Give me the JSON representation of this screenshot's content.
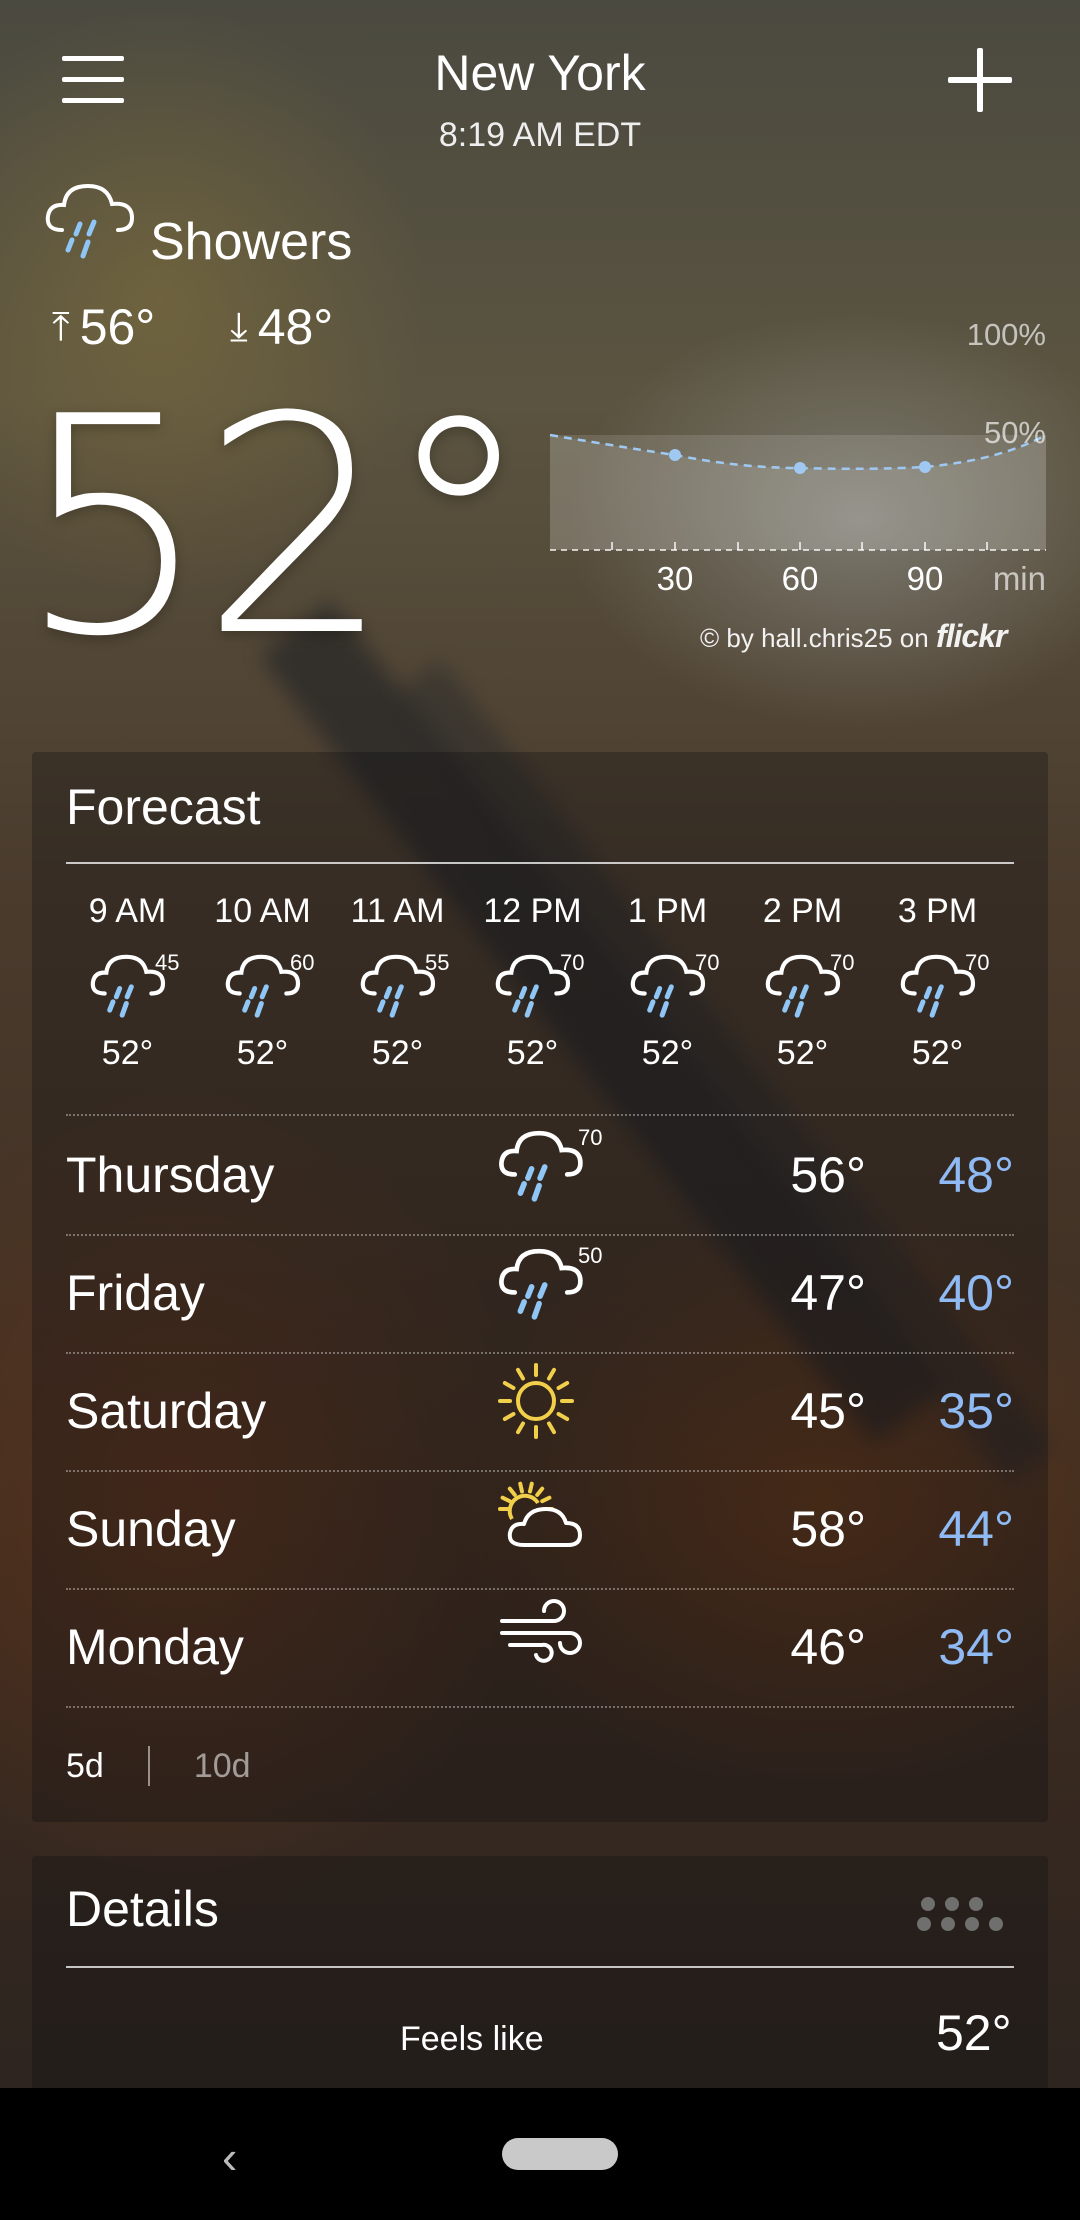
{
  "header": {
    "city": "New York",
    "time": "8:19 AM EDT"
  },
  "current": {
    "condition": "Showers",
    "high": "56°",
    "low": "48°",
    "temperature": "52°"
  },
  "precip_chart": {
    "y_labels": [
      "100%",
      "50%"
    ],
    "x_labels": [
      "30",
      "60",
      "90"
    ],
    "unit": "min"
  },
  "credit": {
    "prefix": "© by hall.chris25 on",
    "brand": "flickr"
  },
  "forecast": {
    "title": "Forecast",
    "hourly": [
      {
        "time": "9 AM",
        "precip": "45",
        "temp": "52°",
        "icon": "rain-cloud-icon"
      },
      {
        "time": "10 AM",
        "precip": "60",
        "temp": "52°",
        "icon": "rain-cloud-icon"
      },
      {
        "time": "11 AM",
        "precip": "55",
        "temp": "52°",
        "icon": "rain-cloud-icon"
      },
      {
        "time": "12 PM",
        "precip": "70",
        "temp": "52°",
        "icon": "rain-cloud-icon"
      },
      {
        "time": "1 PM",
        "precip": "70",
        "temp": "52°",
        "icon": "rain-cloud-icon"
      },
      {
        "time": "2 PM",
        "precip": "70",
        "temp": "52°",
        "icon": "rain-cloud-icon"
      },
      {
        "time": "3 PM",
        "precip": "70",
        "temp": "52°",
        "icon": "rain-cloud-icon"
      }
    ],
    "daily": [
      {
        "day": "Thursday",
        "precip": "70",
        "high": "56°",
        "low": "48°",
        "icon": "rain-cloud-icon"
      },
      {
        "day": "Friday",
        "precip": "50",
        "high": "47°",
        "low": "40°",
        "icon": "rain-cloud-icon"
      },
      {
        "day": "Saturday",
        "precip": "",
        "high": "45°",
        "low": "35°",
        "icon": "sun-icon"
      },
      {
        "day": "Sunday",
        "precip": "",
        "high": "58°",
        "low": "44°",
        "icon": "partly-cloudy-icon"
      },
      {
        "day": "Monday",
        "precip": "",
        "high": "46°",
        "low": "34°",
        "icon": "wind-icon"
      }
    ],
    "tab_5d": "5d",
    "tab_10d": "10d"
  },
  "details": {
    "title": "Details",
    "feels_like_label": "Feels like",
    "feels_like_value": "52°"
  },
  "colors": {
    "low_temp": "#8fbaf4",
    "rain_drop": "#8fc6f5",
    "sun": "#f2cf4a"
  }
}
